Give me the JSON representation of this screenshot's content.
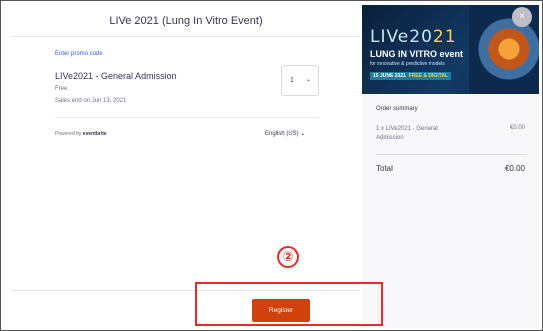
{
  "modal": {
    "title": "LIVe 2021 (Lung In Vitro Event)"
  },
  "ticket_panel": {
    "promo_link": "Enter promo code",
    "ticket_name": "LIVe2021 - General Admission",
    "price": "Free",
    "sales_end": "Sales end on Jun 13, 2021",
    "quantity": "1",
    "powered_by_prefix": "Powered by",
    "powered_by_brand": "eventbrite",
    "language": "English (US)",
    "register_label": "Register"
  },
  "annotation": {
    "step_number": "②",
    "color": "#e52d2d"
  },
  "banner": {
    "title_main": "LIVe20",
    "title_year": "21",
    "subtitle": "LUNG IN VITRO event",
    "tagline": "for innovative & predictive models",
    "date": "15 JUNE 2021",
    "free_digital": "FREE & DIGITAL"
  },
  "order_summary": {
    "heading": "Order summary",
    "line_item": "1 x LIVe2021 - General Admission",
    "line_price": "€0.00",
    "total_label": "Total",
    "total_value": "€0.00"
  },
  "close_label": "×",
  "colors": {
    "brand_register": "#d1410c",
    "link": "#3659e3",
    "summary_bg": "#f8f7fa"
  }
}
